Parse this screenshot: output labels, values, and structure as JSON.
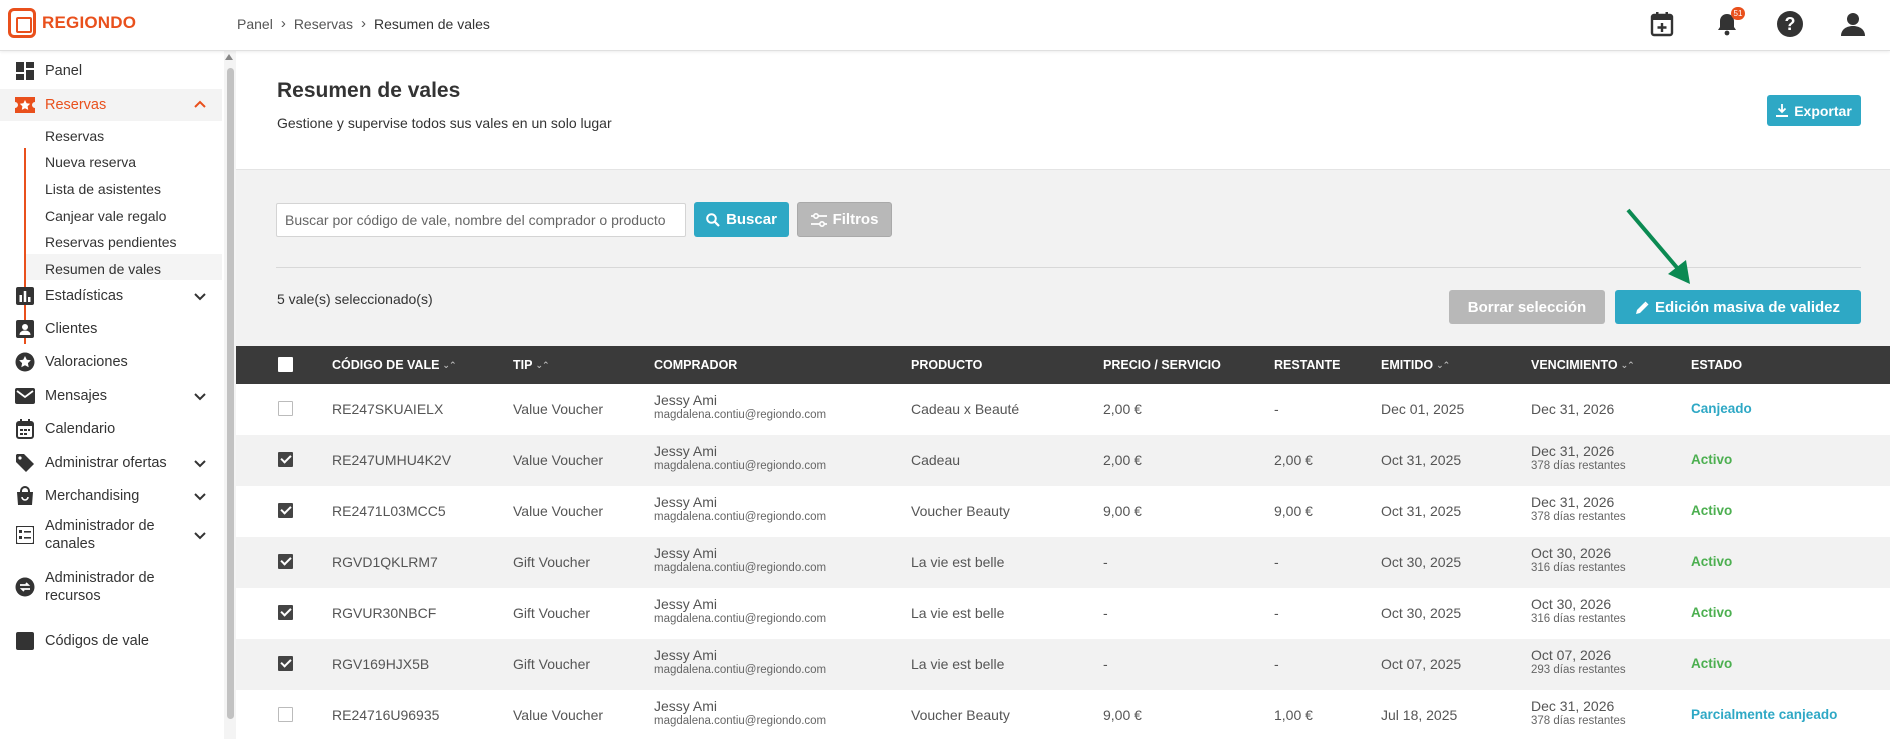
{
  "brand": {
    "name": "REGIONDO",
    "color": "#e9501c"
  },
  "breadcrumb": [
    "Panel",
    "Reservas",
    "Resumen de vales"
  ],
  "topbar": {
    "notifications_count": "51"
  },
  "sidebar": {
    "items": [
      {
        "label": "Panel",
        "icon": "dashboard-icon"
      },
      {
        "label": "Reservas",
        "icon": "star-ticket-icon"
      },
      {
        "label": "Estadísticas",
        "icon": "bar-chart-icon"
      },
      {
        "label": "Clientes",
        "icon": "person-icon"
      },
      {
        "label": "Valoraciones",
        "icon": "star-circle-icon"
      },
      {
        "label": "Mensajes",
        "icon": "mail-icon"
      },
      {
        "label": "Calendario",
        "icon": "calendar-icon"
      },
      {
        "label": "Administrar ofertas",
        "icon": "tag-icon"
      },
      {
        "label": "Merchandising",
        "icon": "shopping-bag-icon"
      },
      {
        "label": "Administrador de canales",
        "icon": "channels-icon"
      },
      {
        "label": "Administrador de recursos",
        "icon": "resources-icon"
      },
      {
        "label": "Códigos de vale",
        "icon": "voucher-code-icon"
      }
    ],
    "reservas_sub": [
      "Reservas",
      "Nueva reserva",
      "Lista de asistentes",
      "Canjear vale regalo",
      "Reservas pendientes",
      "Resumen de vales"
    ]
  },
  "page": {
    "title": "Resumen de vales",
    "subtitle": "Gestione y supervise todos sus vales en un solo lugar",
    "export_label": "Exportar"
  },
  "search": {
    "placeholder": "Buscar por código de vale, nombre del comprador o producto",
    "search_label": "Buscar",
    "filters_label": "Filtros"
  },
  "selection": {
    "count_text": "5 vale(s) seleccionado(s)",
    "clear_label": "Borrar selección",
    "bulk_edit_label": "Edición masiva de validez"
  },
  "table": {
    "headers": [
      "CÓDIGO DE VALE",
      "TIP",
      "COMPRADOR",
      "PRODUCTO",
      "PRECIO / SERVICIO",
      "RESTANTE",
      "EMITIDO",
      "VENCIMIENTO",
      "ESTADO"
    ],
    "rows": [
      {
        "checked": false,
        "code": "RE247SKUAIELX",
        "type": "Value Voucher",
        "buyer": "Jessy Ami",
        "email": "magdalena.contiu@regiondo.com",
        "product": "Cadeau x Beauté",
        "price": "2,00 €",
        "remaining": "-",
        "issued": "Dec 01, 2025",
        "expiry": "Dec 31, 2026",
        "expiry_note": "",
        "status": "Canjeado",
        "status_color": "#2ea8c5"
      },
      {
        "checked": true,
        "code": "RE247UMHU4K2V",
        "type": "Value Voucher",
        "buyer": "Jessy Ami",
        "email": "magdalena.contiu@regiondo.com",
        "product": "Cadeau",
        "price": "2,00 €",
        "remaining": "2,00 €",
        "issued": "Oct 31, 2025",
        "expiry": "Dec 31, 2026",
        "expiry_note": "378 días restantes",
        "status": "Activo",
        "status_color": "#4caf50"
      },
      {
        "checked": true,
        "code": "RE2471L03MCC5",
        "type": "Value Voucher",
        "buyer": "Jessy Ami",
        "email": "magdalena.contiu@regiondo.com",
        "product": "Voucher Beauty",
        "price": "9,00 €",
        "remaining": "9,00 €",
        "issued": "Oct 31, 2025",
        "expiry": "Dec 31, 2026",
        "expiry_note": "378 días restantes",
        "status": "Activo",
        "status_color": "#4caf50"
      },
      {
        "checked": true,
        "code": "RGVD1QKLRM7",
        "type": "Gift Voucher",
        "buyer": "Jessy Ami",
        "email": "magdalena.contiu@regiondo.com",
        "product": "La vie est belle",
        "price": "-",
        "remaining": "-",
        "issued": "Oct 30, 2025",
        "expiry": "Oct 30, 2026",
        "expiry_note": "316 días restantes",
        "status": "Activo",
        "status_color": "#4caf50"
      },
      {
        "checked": true,
        "code": "RGVUR30NBCF",
        "type": "Gift Voucher",
        "buyer": "Jessy Ami",
        "email": "magdalena.contiu@regiondo.com",
        "product": "La vie est belle",
        "price": "-",
        "remaining": "-",
        "issued": "Oct 30, 2025",
        "expiry": "Oct 30, 2026",
        "expiry_note": "316 días restantes",
        "status": "Activo",
        "status_color": "#4caf50"
      },
      {
        "checked": true,
        "code": "RGV169HJX5B",
        "type": "Gift Voucher",
        "buyer": "Jessy Ami",
        "email": "magdalena.contiu@regiondo.com",
        "product": "La vie est belle",
        "price": "-",
        "remaining": "-",
        "issued": "Oct 07, 2025",
        "expiry": "Oct 07, 2026",
        "expiry_note": "293 días restantes",
        "status": "Activo",
        "status_color": "#4caf50"
      },
      {
        "checked": false,
        "code": "RE24716U96935",
        "type": "Value Voucher",
        "buyer": "Jessy Ami",
        "email": "magdalena.contiu@regiondo.com",
        "product": "Voucher Beauty",
        "price": "9,00 €",
        "remaining": "1,00 €",
        "issued": "Jul 18, 2025",
        "expiry": "Dec 31, 2026",
        "expiry_note": "378 días restantes",
        "status": "Parcialmente canjeado",
        "status_color": "#2ea8c5"
      }
    ]
  },
  "annotation_arrow_color": "#0b8a52"
}
